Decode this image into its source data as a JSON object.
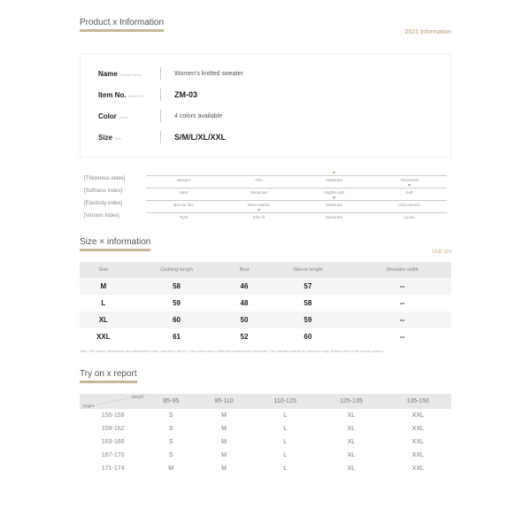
{
  "header": {
    "title": "Product x Information",
    "sub": "2021 Information"
  },
  "info": {
    "name": {
      "label": "Name",
      "sub": "Product Name",
      "val": "Women's knitted sweater"
    },
    "item": {
      "label": "Item No.",
      "sub": "Model No.",
      "val": "ZM-03"
    },
    "color": {
      "label": "Color",
      "sub": "Colour",
      "val": "4 colors available"
    },
    "size": {
      "label": "Size",
      "sub": "Size",
      "val": "S/M/L/XL/XXL"
    }
  },
  "idx": {
    "thickness": {
      "label": "[Thickness index]",
      "o0": "Meager",
      "o1": "Thin",
      "o2": "Moderate",
      "o3": "Thick/Heel"
    },
    "softness": {
      "label": "[Softness Index]",
      "o0": "Hard",
      "o1": "Moderate",
      "o2": "Slightly soft",
      "o3": "Soft"
    },
    "elasticity": {
      "label": "[Elasticity index]",
      "o0": "But No flex",
      "o1": "Micro-elastic",
      "o2": "Moderate",
      "o3": "Ultra-stretch"
    },
    "version": {
      "label": "[Version Index]",
      "o0": "Tight",
      "o1": "Slim fit",
      "o2": "Moderate",
      "o3": "Loose"
    }
  },
  "sizeTitle": "Size × information",
  "unit": "Unit: cm",
  "sizeCols": {
    "c0": "Size",
    "c1": "Clothing length",
    "c2": "Bust",
    "c3": "Sleeve length",
    "c4": "Shoulder width"
  },
  "sizeRows": {
    "r0": {
      "c0": "M",
      "c1": "58",
      "c2": "46",
      "c3": "57",
      "c4": "--"
    },
    "r1": {
      "c0": "L",
      "c1": "59",
      "c2": "48",
      "c3": "58",
      "c4": "--"
    },
    "r2": {
      "c0": "XL",
      "c1": "60",
      "c2": "50",
      "c3": "59",
      "c4": "--"
    },
    "r3": {
      "c0": "XXL",
      "c1": "61",
      "c2": "52",
      "c3": "60",
      "c4": "--"
    }
  },
  "sizeNote": "Note: The above dimensions are measured in kind, and there will be 1-3cm error due to different measurement methods. The relevant data is for reference only. Please refer to the actual product.",
  "tryTitle": "Try on x report",
  "tryCorner": {
    "w": "Weight",
    "h": "Height"
  },
  "tryCols": {
    "c1": "85-95",
    "c2": "95-110",
    "c3": "110-125",
    "c4": "125-135",
    "c5": "135-150"
  },
  "tryRows": {
    "r0": {
      "c0": "155-158",
      "c1": "S",
      "c2": "M",
      "c3": "L",
      "c4": "XL",
      "c5": "XXL"
    },
    "r1": {
      "c0": "159-162",
      "c1": "S",
      "c2": "M",
      "c3": "L",
      "c4": "XL",
      "c5": "XXL"
    },
    "r2": {
      "c0": "163-166",
      "c1": "S",
      "c2": "M",
      "c3": "L",
      "c4": "XL",
      "c5": "XXL"
    },
    "r3": {
      "c0": "167-170",
      "c1": "S",
      "c2": "M",
      "c3": "L",
      "c4": "XL",
      "c5": "XXL"
    },
    "r4": {
      "c0": "171-174",
      "c1": "M",
      "c2": "M",
      "c3": "L",
      "c4": "XL",
      "c5": "XXL"
    }
  }
}
